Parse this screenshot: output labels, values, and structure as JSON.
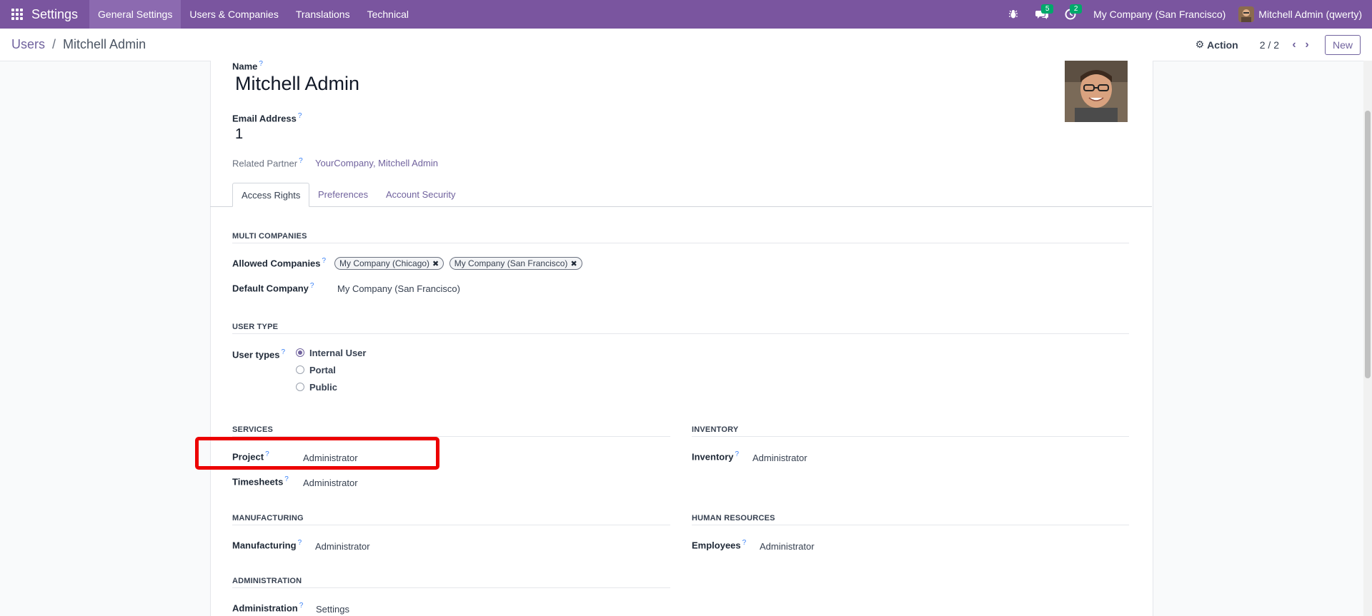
{
  "navbar": {
    "app_title": "Settings",
    "menu": [
      "General Settings",
      "Users & Companies",
      "Translations",
      "Technical"
    ],
    "messages_badge": "5",
    "activities_badge": "2",
    "company": "My Company (San Francisco)",
    "user": "Mitchell Admin (qwerty)"
  },
  "breadcrumb": {
    "parent": "Users",
    "separator": "/",
    "current": "Mitchell Admin"
  },
  "control": {
    "action_label": "Action",
    "pager": "2 / 2",
    "new_label": "New"
  },
  "form": {
    "name_label": "Name",
    "name_value": "Mitchell Admin",
    "email_label": "Email Address",
    "email_value": "1",
    "partner_label": "Related Partner",
    "partner_value": "YourCompany, Mitchell Admin",
    "help_mark": "?"
  },
  "tabs": [
    "Access Rights",
    "Preferences",
    "Account Security"
  ],
  "multi_companies": {
    "title": "MULTI COMPANIES",
    "allowed_label": "Allowed Companies",
    "allowed_tags": [
      "My Company (Chicago)",
      "My Company (San Francisco)"
    ],
    "default_label": "Default Company",
    "default_value": "My Company (San Francisco)"
  },
  "user_type": {
    "title": "USER TYPE",
    "label": "User types",
    "options": [
      "Internal User",
      "Portal",
      "Public"
    ],
    "selected": "Internal User"
  },
  "services": {
    "title": "SERVICES",
    "project_label": "Project",
    "project_value": "Administrator",
    "timesheets_label": "Timesheets",
    "timesheets_value": "Administrator"
  },
  "inventory": {
    "title": "INVENTORY",
    "label": "Inventory",
    "value": "Administrator"
  },
  "manufacturing": {
    "title": "MANUFACTURING",
    "label": "Manufacturing",
    "value": "Administrator"
  },
  "human_resources": {
    "title": "HUMAN RESOURCES",
    "label": "Employees",
    "value": "Administrator"
  },
  "administration": {
    "title": "ADMINISTRATION",
    "label": "Administration",
    "value": "Settings"
  },
  "colors": {
    "navbar": "#7a559f",
    "link": "#71639e",
    "highlight": "#ec0000",
    "badge": "#00a86b"
  }
}
